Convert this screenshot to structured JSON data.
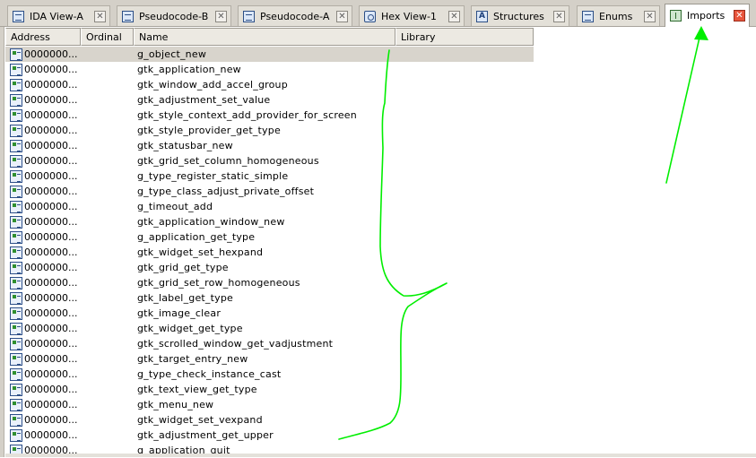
{
  "tabs": [
    {
      "label": "IDA View-A",
      "icon": "ida-view-icon"
    },
    {
      "label": "Pseudocode-B",
      "icon": "pseudocode-icon"
    },
    {
      "label": "Pseudocode-A",
      "icon": "pseudocode-icon"
    },
    {
      "label": "Hex View-1",
      "icon": "hex-view-icon"
    },
    {
      "label": "Structures",
      "icon": "structures-icon"
    },
    {
      "label": "Enums",
      "icon": "enums-icon"
    },
    {
      "label": "Imports",
      "icon": "imports-icon",
      "active": true
    }
  ],
  "close_glyph": "✕",
  "columns": [
    "Address",
    "Ordinal",
    "Name",
    "Library"
  ],
  "rows": [
    {
      "address": "0000000...",
      "name": "g_object_new"
    },
    {
      "address": "0000000...",
      "name": "gtk_application_new"
    },
    {
      "address": "0000000...",
      "name": "gtk_window_add_accel_group"
    },
    {
      "address": "0000000...",
      "name": "gtk_adjustment_set_value"
    },
    {
      "address": "0000000...",
      "name": "gtk_style_context_add_provider_for_screen"
    },
    {
      "address": "0000000...",
      "name": "gtk_style_provider_get_type"
    },
    {
      "address": "0000000...",
      "name": "gtk_statusbar_new"
    },
    {
      "address": "0000000...",
      "name": "gtk_grid_set_column_homogeneous"
    },
    {
      "address": "0000000...",
      "name": "g_type_register_static_simple"
    },
    {
      "address": "0000000...",
      "name": "g_type_class_adjust_private_offset"
    },
    {
      "address": "0000000...",
      "name": "g_timeout_add"
    },
    {
      "address": "0000000...",
      "name": "gtk_application_window_new"
    },
    {
      "address": "0000000...",
      "name": "g_application_get_type"
    },
    {
      "address": "0000000...",
      "name": "gtk_widget_set_hexpand"
    },
    {
      "address": "0000000...",
      "name": "gtk_grid_get_type"
    },
    {
      "address": "0000000...",
      "name": "gtk_grid_set_row_homogeneous"
    },
    {
      "address": "0000000...",
      "name": "gtk_label_get_type"
    },
    {
      "address": "0000000...",
      "name": "gtk_image_clear"
    },
    {
      "address": "0000000...",
      "name": "gtk_widget_get_type"
    },
    {
      "address": "0000000...",
      "name": "gtk_scrolled_window_get_vadjustment"
    },
    {
      "address": "0000000...",
      "name": "gtk_target_entry_new"
    },
    {
      "address": "0000000...",
      "name": "g_type_check_instance_cast"
    },
    {
      "address": "0000000...",
      "name": "gtk_text_view_get_type"
    },
    {
      "address": "0000000...",
      "name": "gtk_menu_new"
    },
    {
      "address": "0000000...",
      "name": "gtk_widget_set_vexpand"
    },
    {
      "address": "0000000...",
      "name": "gtk_adjustment_get_upper"
    },
    {
      "address": "0000000...",
      "name": "g_application_quit"
    }
  ],
  "selected_row": 0,
  "annotation_color": "#00ee00"
}
